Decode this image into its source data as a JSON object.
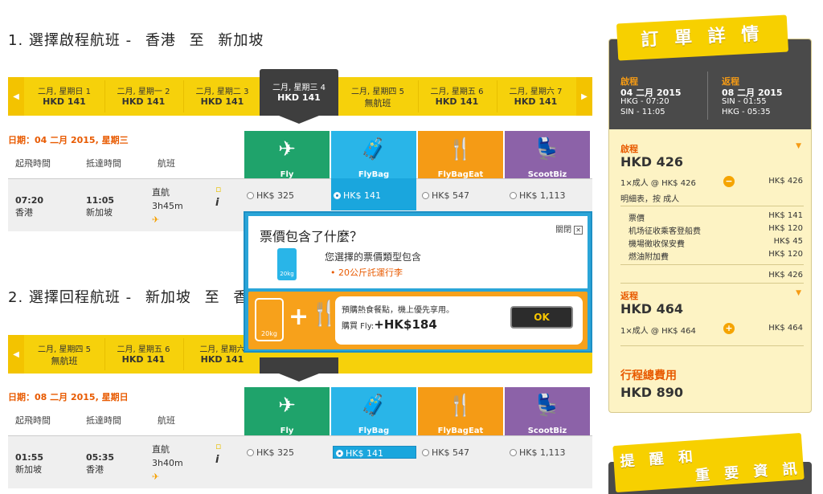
{
  "outbound": {
    "title": "1. 選擇啟程航班 -",
    "from": "香港",
    "to_word": "至",
    "to": "新加坡",
    "dates": [
      {
        "day": "二月, 星期日 1",
        "price": "HKD 141"
      },
      {
        "day": "二月, 星期一 2",
        "price": "HKD 141"
      },
      {
        "day": "二月, 星期二 3",
        "price": "HKD 141"
      },
      {
        "day": "二月, 星期三 4",
        "price": "HKD 141"
      },
      {
        "day": "二月, 星期四 5",
        "price": "無航班"
      },
      {
        "day": "二月, 星期五 6",
        "price": "HKD 141"
      },
      {
        "day": "二月, 星期六 7",
        "price": "HKD 141"
      }
    ],
    "date_label": "日期：04 二月 2015, 星期三",
    "flight": {
      "dep_time": "07:20",
      "dep_city": "香港",
      "arr_time": "11:05",
      "arr_city": "新加坡",
      "type": "直航",
      "duration": "3h45m"
    },
    "fares": [
      "HK$ 325",
      "HK$ 141",
      "HK$ 547",
      "HK$ 1,113"
    ]
  },
  "return": {
    "title": "2. 選擇回程航班 -",
    "from": "新加坡",
    "to_word": "至",
    "to": "香港",
    "dates": [
      {
        "day": "二月, 星期四 5",
        "price": "無航班"
      },
      {
        "day": "二月, 星期五 6",
        "price": "HKD 141"
      },
      {
        "day": "二月, 星期六",
        "price": "HKD 141"
      }
    ],
    "date_label": "日期：08 二月 2015, 星期日",
    "flight": {
      "dep_time": "01:55",
      "dep_city": "新加坡",
      "arr_time": "05:35",
      "arr_city": "香港",
      "type": "直航",
      "duration": "3h40m"
    },
    "fares": [
      "HK$ 325",
      "HK$ 141",
      "HK$ 547",
      "HK$ 1,113"
    ]
  },
  "columns": {
    "depart": "起飛時間",
    "arrive": "抵達時間",
    "flight": "航班"
  },
  "fare_types": [
    "Fly",
    "FlyBag",
    "FlyBagEat",
    "ScootBiz"
  ],
  "popup": {
    "title": "票價包含了什麼？",
    "close": "關閉",
    "desc": "您選擇的票價類型包含",
    "item": "20公斤託運行李",
    "bag_kg": "20kg",
    "upsell_text": "預購熱食餐點，機上優先享用。",
    "upsell_buy": "購買 Fly:",
    "upsell_price": "+HK$184",
    "ok": "OK"
  },
  "sidebar": {
    "title": "訂 單 詳 情",
    "depart_label": "啟程",
    "depart_date": "04 二月 2015",
    "depart_l1": "HKG - 07:20",
    "depart_l2": "SIN - 11:05",
    "return_label": "返程",
    "return_date": "08 二月 2015",
    "return_l1": "SIN - 01:55",
    "return_l2": "HKG - 05:35",
    "out_section": "啟程",
    "out_total": "HKD 426",
    "out_pax": "1×成人 @",
    "out_unit": "HK$ 426",
    "out_amt": "HK$ 426",
    "breakdown_title": "明細表，按 成人",
    "breakdown": [
      {
        "name": "票價",
        "amt": "HK$ 141"
      },
      {
        "name": "机场征收乘客登船费",
        "amt": "HK$ 120"
      },
      {
        "name": "機場徵收保安費",
        "amt": "HK$ 45"
      },
      {
        "name": "燃油附加費",
        "amt": "HK$ 120"
      }
    ],
    "breakdown_total": "HK$ 426",
    "ret_section": "返程",
    "ret_total": "HKD 464",
    "ret_pax": "1×成人 @",
    "ret_unit": "HK$ 464",
    "ret_amt": "HK$ 464",
    "grand_label": "行程總費用",
    "grand_total": "HKD 890",
    "reminder_1": "提 醒 和",
    "reminder_2": "重 要 資 訊"
  }
}
